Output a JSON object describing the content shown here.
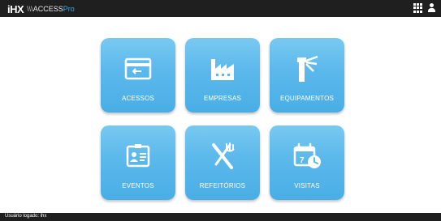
{
  "header": {
    "logo_mark": "iHX",
    "logo_separator": "\\\\\\",
    "logo_access": "ACCESS",
    "logo_pro": "Pro"
  },
  "tiles": [
    {
      "label": "ACESSOS",
      "icon": "card-reader-icon"
    },
    {
      "label": "EMPRESAS",
      "icon": "factory-icon"
    },
    {
      "label": "EQUIPAMENTOS",
      "icon": "turnstile-icon"
    },
    {
      "label": "EVENTOS",
      "icon": "id-card-icon"
    },
    {
      "label": "REFEITÓRIOS",
      "icon": "fork-knife-icon"
    },
    {
      "label": "VISITAS",
      "icon": "calendar-clock-icon"
    }
  ],
  "status": {
    "text": "Usuário logado: ihx"
  },
  "colors": {
    "bar": "#1f1f1f",
    "tile": "#5bb8eb",
    "accent": "#4aa3df"
  }
}
